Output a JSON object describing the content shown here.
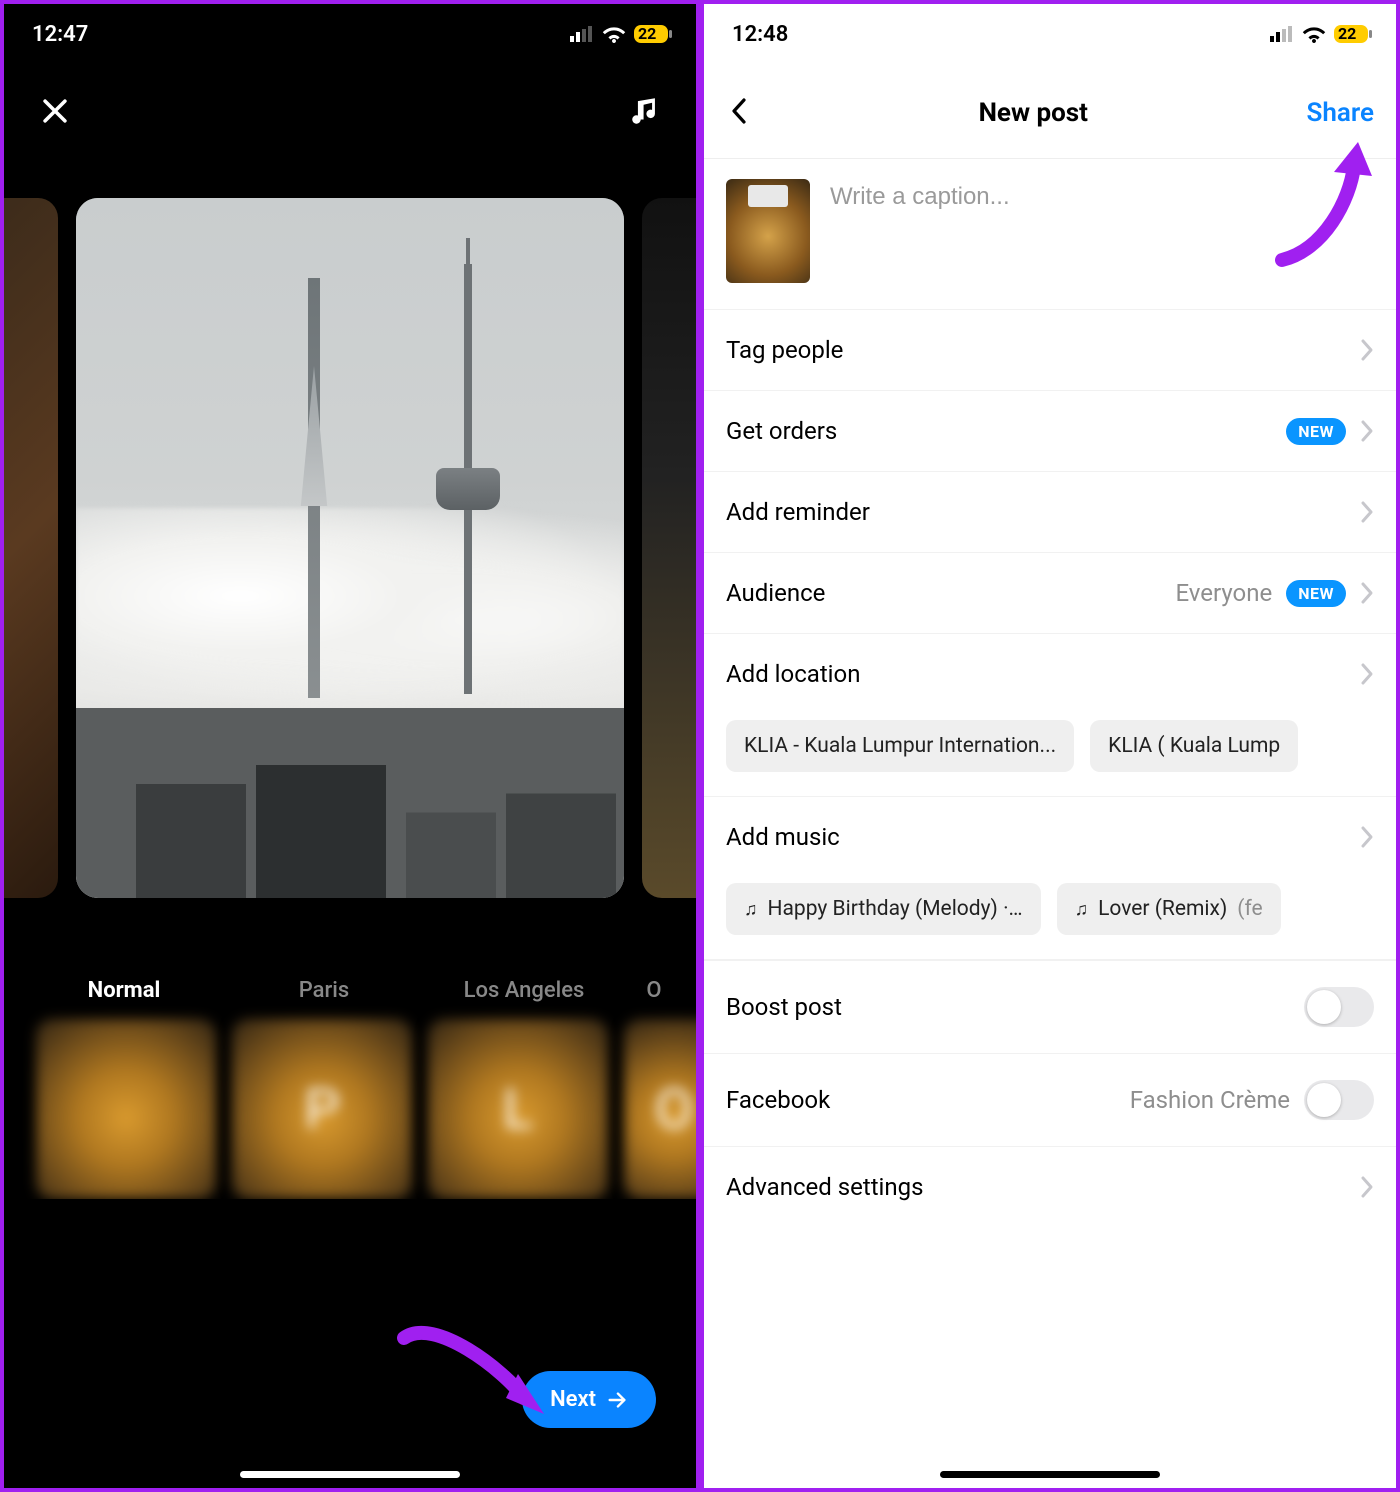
{
  "left": {
    "status": {
      "time": "12:47",
      "battery": "22"
    },
    "filters": {
      "items": [
        "Normal",
        "Paris",
        "Los Angeles",
        "O"
      ],
      "tileLetters": [
        "",
        "P",
        "L",
        "O"
      ]
    },
    "nextLabel": "Next"
  },
  "right": {
    "status": {
      "time": "12:48",
      "battery": "22"
    },
    "header": {
      "title": "New post",
      "share": "Share"
    },
    "captionPlaceholder": "Write a caption...",
    "rows": {
      "tagPeople": "Tag people",
      "getOrders": "Get orders",
      "addReminder": "Add reminder",
      "audience": "Audience",
      "audienceValue": "Everyone",
      "addLocation": "Add location",
      "addMusic": "Add music",
      "boostPost": "Boost post",
      "facebook": "Facebook",
      "facebookValue": "Fashion Crème",
      "advanced": "Advanced settings",
      "newBadge": "NEW"
    },
    "locationChips": [
      "KLIA - Kuala Lumpur Internation...",
      "KLIA ( Kuala Lump"
    ],
    "musicChips": [
      {
        "icon": "♫",
        "text": "Happy Birthday (Melody) ·…"
      },
      {
        "icon": "♫",
        "text": "Lover (Remix)",
        "sub": "(fe"
      }
    ]
  }
}
